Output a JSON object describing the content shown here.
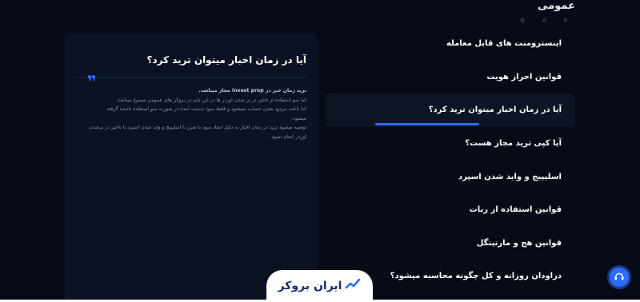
{
  "section": {
    "title": "عمومی",
    "letters": "Q A F"
  },
  "answer": {
    "title": "آیا در زمان اخبار میتوان ترید کرد؟",
    "lead": "ترید زمان خبر در invest prop مجاز میباشد.",
    "lines": [
      "اما سو استفاده از تاخیر در پر شدن اوردر ها در این تایم در بروکر های عمومی ممنوع میباشد.",
      "اما باعث مردود شدن حساب نمیشود و فقط سود بدست آمده در صورت سو استفاده نادیده گرفته",
      "میشود."
    ],
    "lines2": [
      "توصیه میشود ترید در زمان اخبار به دلیل ایجاد سود با ضرر با اسلیپیج و واید شدن اسپرد با تاخیر در برشدن",
      "اوردر انجام نشود."
    ]
  },
  "questions": [
    {
      "label": "اینسترومنت های قابل معامله",
      "active": false
    },
    {
      "label": "قوانین احراز هویت",
      "active": false
    },
    {
      "label": "آیا در زمان اخبار میتوان ترید کرد؟",
      "active": true
    },
    {
      "label": "آیا کپی ترید مجاز هست؟",
      "active": false
    },
    {
      "label": "اسلیپیج و واید شدن اسپرد",
      "active": false
    },
    {
      "label": "قوانین استفاده از ربات",
      "active": false
    },
    {
      "label": "قوانین هج و مارتینگل",
      "active": false
    },
    {
      "label": "دراودان روزانه و کل چگونه محاسبه میشود؟",
      "active": false
    }
  ],
  "brand": {
    "name": "ایران بروکر",
    "color": "#1a2b6b"
  },
  "colors": {
    "accent": "#2f6bff",
    "background": "#060b17",
    "panel": "#0b1222"
  },
  "icons": {
    "quote": "quote-icon",
    "support": "headset-icon",
    "logo": "chart-logo-icon"
  }
}
